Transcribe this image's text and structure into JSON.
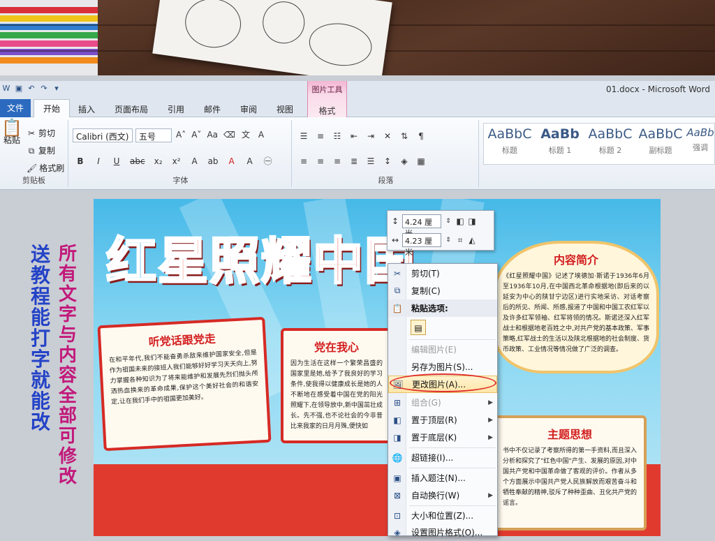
{
  "window": {
    "doc_title": "01.docx - Microsoft Word",
    "context_tab_group": "图片工具",
    "context_tab": "格式"
  },
  "tabs": [
    "文件",
    "开始",
    "插入",
    "页面布局",
    "引用",
    "邮件",
    "审阅",
    "视图"
  ],
  "ribbon": {
    "clipboard": {
      "paste": "粘贴",
      "cut": "剪切",
      "copy": "复制",
      "format_painter": "格式刷",
      "label": "剪贴板"
    },
    "font": {
      "name": "Calibri (西文)",
      "size": "五号",
      "label": "字体"
    },
    "paragraph": {
      "label": "段落"
    },
    "styles": [
      {
        "sample": "AaBbC",
        "name": "标题"
      },
      {
        "sample": "AaBb",
        "name": "标题 1"
      },
      {
        "sample": "AaBbC",
        "name": "标题 2"
      },
      {
        "sample": "AaBbC",
        "name": "副标题"
      },
      {
        "sample": "AaBb",
        "name": "强调"
      }
    ]
  },
  "side_text": {
    "left": "送教程 能打字就能改",
    "right": "所有文字与内容全部可修改"
  },
  "poster": {
    "title": [
      "红",
      "星",
      "照",
      "耀",
      "中",
      "国"
    ],
    "title_colors": [
      "#1a9be0",
      "#e8402a",
      "#2fa843",
      "#f28a1c",
      "#d8231d",
      "#d8231d"
    ],
    "box1": {
      "heading": "听党话跟党走",
      "body": "在和平年代,我们不能奋勇杀敌来维护国家安全,但是作为祖国未来的接班人我们能够好好学习天天向上,努力掌握各种知识为了将来能维护和发展先烈们抛头颅洒热血换来的革命成果,保护这个美好社会的和谐安定,让在我们手中的祖国更加美好。"
    },
    "box2": {
      "heading": "党在我心",
      "body": "因为生活在这样一个繁荣昌盛的国家里是她,给予了我良好的学习条件,使我得以健康成长是她的人不断地在感受着中国在党的阳光照耀下,在领导放中,新中国茁壮成长。先不强,也不论社会的今非昔比来我家的日月月殊,便快如"
    },
    "box3": {
      "heading": "内容简介",
      "body": "《红星照耀中国》记述了埃德加·斯诺于1936年6月至1936年10月,在中国西北革命根据地(即后来的以延安为中心的陕甘宁边区)进行实地采访、对话考察后的所见、所闻、所感,报道了中国和中国工农红军以及许多红军领袖、红军将领的情况。斯诺还深入红军战士和根据地老百姓之中,对共产党的基本政策、军事策略,红军战士的生活以及陕北根据地的社会制度、货币政策、工业情况等情况做了广泛的调查。"
    },
    "box4": {
      "heading": "主题思想",
      "body": "书中不仅记录了考察所得的第一手资料,而且深入分析和探究了\"红色中国\"产生、发展的原因,对中国共产党和中国革命做了客观的评价。作者从多个方面展示中国共产党人民族解放而艰苦奋斗和牺牲奉献的精神,驳斥了种种歪曲、丑化共产党的谣言。"
    }
  },
  "size_box": {
    "height": "4.24 厘米",
    "width": "4.23 厘米"
  },
  "context_menu": [
    {
      "label": "剪切(T)",
      "icon": "scissors-icon",
      "enabled": true
    },
    {
      "label": "复制(C)",
      "icon": "copy-icon",
      "enabled": true
    },
    {
      "label": "粘贴选项:",
      "icon": "paste-icon",
      "enabled": true,
      "bold": true
    },
    {
      "label": "",
      "icon": "clipboard-icon",
      "enabled": true
    },
    {
      "label": "编辑图片(E)",
      "icon": "",
      "enabled": false
    },
    {
      "label": "另存为图片(S)...",
      "icon": "",
      "enabled": true
    },
    {
      "label": "更改图片(A)...",
      "icon": "change-picture-icon",
      "enabled": true,
      "highlight": true
    },
    {
      "label": "组合(G)",
      "icon": "group-icon",
      "enabled": false,
      "submenu": true
    },
    {
      "label": "置于顶层(R)",
      "icon": "bring-front-icon",
      "enabled": true,
      "submenu": true
    },
    {
      "label": "置于底层(K)",
      "icon": "send-back-icon",
      "enabled": true,
      "submenu": true
    },
    {
      "label": "超链接(I)...",
      "icon": "hyperlink-icon",
      "enabled": true
    },
    {
      "label": "插入题注(N)...",
      "icon": "caption-icon",
      "enabled": true
    },
    {
      "label": "自动换行(W)",
      "icon": "wrap-icon",
      "enabled": true,
      "submenu": true
    },
    {
      "label": "大小和位置(Z)...",
      "icon": "size-position-icon",
      "enabled": true
    },
    {
      "label": "设置图片格式(O)...",
      "icon": "format-picture-icon",
      "enabled": true
    }
  ],
  "colors": {
    "ribbon_file_tab": "#2b6abf",
    "highlight_ring": "#e0302a",
    "poster_red": "#d62a25"
  }
}
